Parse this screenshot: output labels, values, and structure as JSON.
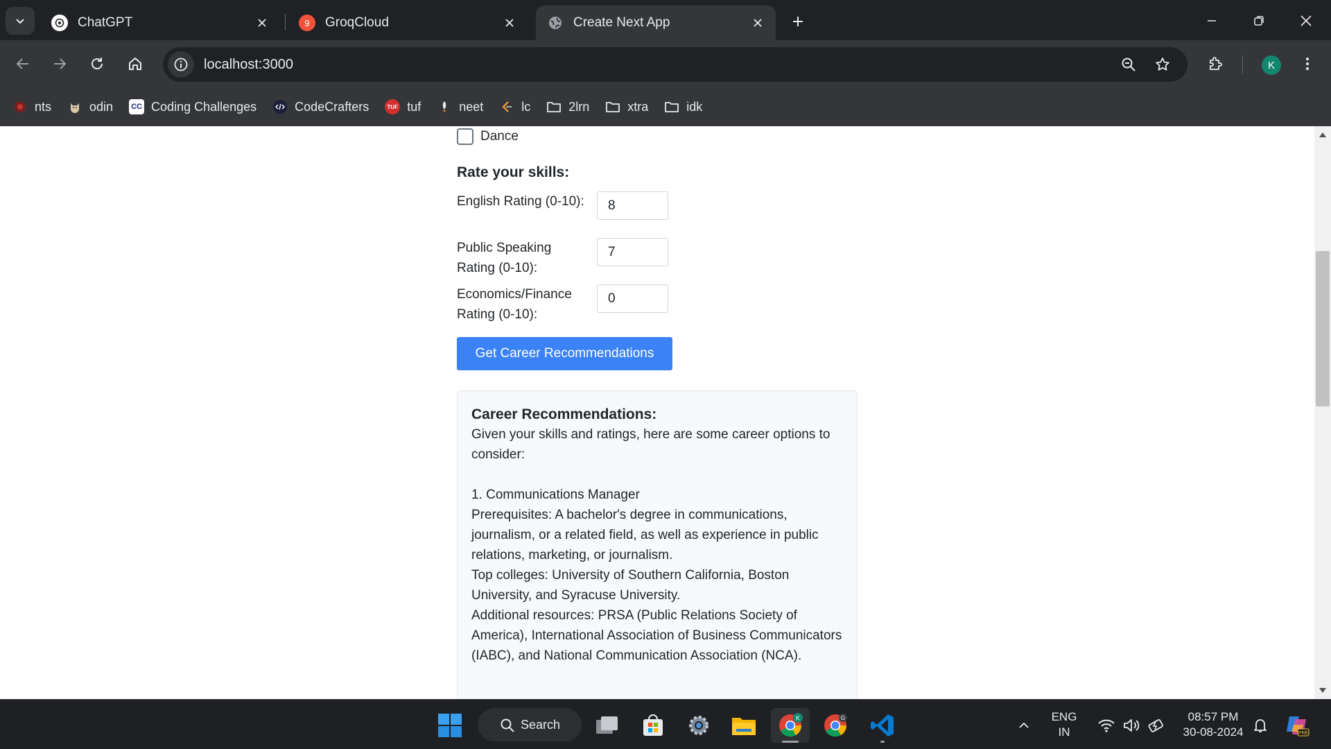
{
  "browser": {
    "tabs": [
      {
        "title": "ChatGPT",
        "icon": "chatgpt-icon",
        "active": false
      },
      {
        "title": "GroqCloud",
        "icon": "groq-icon",
        "badge": "9",
        "active": false
      },
      {
        "title": "Create Next App",
        "icon": "globe-icon",
        "active": true
      }
    ],
    "url": "localhost:3000",
    "profile_initial": "K",
    "accent": "#12866e"
  },
  "bookmarks": [
    {
      "label": "nts",
      "icon": "nts-icon"
    },
    {
      "label": "odin",
      "icon": "odin-icon"
    },
    {
      "label": "Coding Challenges",
      "icon": "cc-icon",
      "icon_text": "CC"
    },
    {
      "label": "CodeCrafters",
      "icon": "codecrafters-icon"
    },
    {
      "label": "tuf",
      "icon": "tuf-icon",
      "icon_text": "TUF"
    },
    {
      "label": "neet",
      "icon": "neet-icon"
    },
    {
      "label": "lc",
      "icon": "leetcode-icon"
    },
    {
      "label": "2lrn",
      "icon": "folder-icon"
    },
    {
      "label": "xtra",
      "icon": "folder-icon"
    },
    {
      "label": "idk",
      "icon": "folder-icon"
    }
  ],
  "page": {
    "dance_label": "Dance",
    "dance_checked": false,
    "skills_title": "Rate your skills:",
    "ratings": [
      {
        "label": "English Rating (0-10):",
        "value": "8"
      },
      {
        "label": "Public Speaking Rating (0-10):",
        "value": "7"
      },
      {
        "label": "Economics/Finance Rating (0-10):",
        "value": "0"
      }
    ],
    "submit_label": "Get Career Recommendations",
    "submit_color": "#3b82f6",
    "results": {
      "title": "Career Recommendations:",
      "intro": "Given your skills and ratings, here are some career options to consider:",
      "item_title": "1. Communications Manager",
      "prerequisites": "Prerequisites: A bachelor's degree in communications, journalism, or a related field, as well as experience in public relations, marketing, or journalism.",
      "colleges": "Top colleges: University of Southern California, Boston University, and Syracuse University.",
      "resources": "Additional resources: PRSA (Public Relations Society of America), International Association of Business Communicators (IABC), and National Communication Association (NCA)."
    }
  },
  "taskbar": {
    "search_label": "Search",
    "lang_line1": "ENG",
    "lang_line2": "IN",
    "time": "08:57 PM",
    "date": "30-08-2024"
  }
}
